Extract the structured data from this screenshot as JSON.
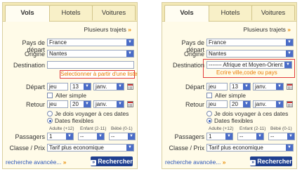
{
  "tabs": [
    "Vols",
    "Hotels",
    "Voitures"
  ],
  "multi": {
    "label": "Plusieurs trajets",
    "arrow": "»"
  },
  "labels": {
    "pays": "Pays de départ",
    "origine": "Origine",
    "destination": "Destination",
    "depart": "Départ",
    "retour": "Retour",
    "passagers": "Passagers",
    "classe": "Classe / Prix"
  },
  "values": {
    "pays": "France",
    "origine": "Nantes",
    "depart_day_name": "jeu",
    "depart_day": "13",
    "depart_month": "janv.",
    "retour_day_name": "jeu",
    "retour_day": "20",
    "retour_month": "janv.",
    "adulte": "1",
    "enfant": "--",
    "bebe": "--",
    "classe": "Tarif plus economique"
  },
  "options": {
    "aller_simple": "Aller simple",
    "dates_fixes": "Je dois voyager à ces dates",
    "dates_flexibles": "Dates flexibles"
  },
  "pax_sub": {
    "adulte": "Adulte (+12)",
    "enfant": "Enfant (2-11)",
    "bebe": "Bébé (0-1)"
  },
  "panel1": {
    "destination_value": "",
    "hint": "Selectionner à partir d'une liste"
  },
  "panel2": {
    "destination_value": "------- Afrique et Moyen-Orient -----",
    "hint": "Ecrire ville,code ou pays"
  },
  "footer": {
    "advanced": "recherche avancée...",
    "advanced_arrow": "»",
    "search": "Rechercher",
    "search_arrow": "»"
  }
}
